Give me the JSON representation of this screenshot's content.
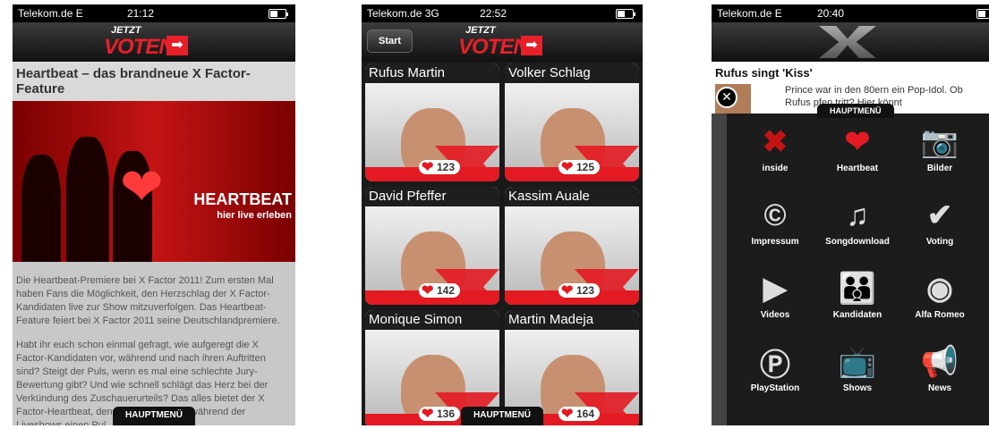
{
  "phone1": {
    "status": {
      "carrier": "Telekom.de  E",
      "time": "21:12"
    },
    "logo": {
      "jetzt": "JETZT",
      "voten": "VOTEN!",
      "arrow": "➡"
    },
    "headline": "Heartbeat – das brandneue X Factor-Feature",
    "banner": {
      "title": "HEARTBEAT",
      "subtitle": "hier live erleben"
    },
    "paragraphs": [
      "Die Heartbeat-Premiere bei X Factor 2011! Zum ersten Mal haben Fans die Möglichkeit, den Herzschlag der X Factor-Kandidaten live zur Show mitzuverfolgen. Das Heartbeat-Feature feiert bei X Factor 2011 seine Deutschlandpremiere.",
      "Habt ihr euch schon einmal gefragt, wie aufgeregt die X Factor-Kandidaten vor, während und nach ihren Auftritten sind? Steigt der Puls, wenn es mal eine schlechte Jury-Bewertung gibt? Und wie schnell schlägt das Herz bei der Verkündung des Zuschauerurteils? Das alles bietet der X Factor-Heartbeat, denn alle Acts tragen während der Liveshows einen Pul"
    ],
    "menu_tab": "HAUPTMENÜ"
  },
  "phone2": {
    "status": {
      "carrier": "Telekom.de  3G",
      "time": "22:52"
    },
    "logo": {
      "jetzt": "JETZT",
      "voten": "VOTEN!",
      "arrow": "➡"
    },
    "back_button": "Start",
    "candidates": [
      {
        "name": "Rufus Martin",
        "votes": "123"
      },
      {
        "name": "Volker Schlag",
        "votes": "125"
      },
      {
        "name": "David Pfeffer",
        "votes": "142"
      },
      {
        "name": "Kassim Auale",
        "votes": "123"
      },
      {
        "name": "Monique Simon",
        "votes": "136"
      },
      {
        "name": "Martin Madeja",
        "votes": "164"
      }
    ],
    "menu_tab": "HAUPTMENÜ"
  },
  "phone3": {
    "status": {
      "carrier": "Telekom.de  E",
      "time": "20:40"
    },
    "article_title": "Rufus singt 'Kiss'",
    "snippet_line1": "Prince war in den 80ern ein Pop-Idol. Ob",
    "snippet_line2": "Rufus           pfen tritt? Hier könnt",
    "menu_tab": "HAUPTMENÜ",
    "close_glyph": "✕",
    "menu_items": [
      {
        "label": "inside",
        "glyph": "✖",
        "icon": "x-factor-logo-icon"
      },
      {
        "label": "Heartbeat",
        "glyph": "❤",
        "icon": "heart-icon"
      },
      {
        "label": "Bilder",
        "glyph": "📷",
        "icon": "camera-icon"
      },
      {
        "label": "Impressum",
        "glyph": "©",
        "icon": "copyright-icon"
      },
      {
        "label": "Songdownload",
        "glyph": "♫",
        "icon": "music-note-icon"
      },
      {
        "label": "Voting",
        "glyph": "✔",
        "icon": "voting-person-icon"
      },
      {
        "label": "Videos",
        "glyph": "▶",
        "icon": "video-film-icon"
      },
      {
        "label": "Kandidaten",
        "glyph": "👪",
        "icon": "people-icon"
      },
      {
        "label": "Alfa Romeo",
        "glyph": "◉",
        "icon": "alfa-romeo-logo-icon"
      },
      {
        "label": "PlayStation",
        "glyph": "Ⓟ",
        "icon": "playstation-logo-icon"
      },
      {
        "label": "Shows",
        "glyph": "📺",
        "icon": "tv-icon"
      },
      {
        "label": "News",
        "glyph": "📢",
        "icon": "megaphone-icon"
      }
    ]
  }
}
